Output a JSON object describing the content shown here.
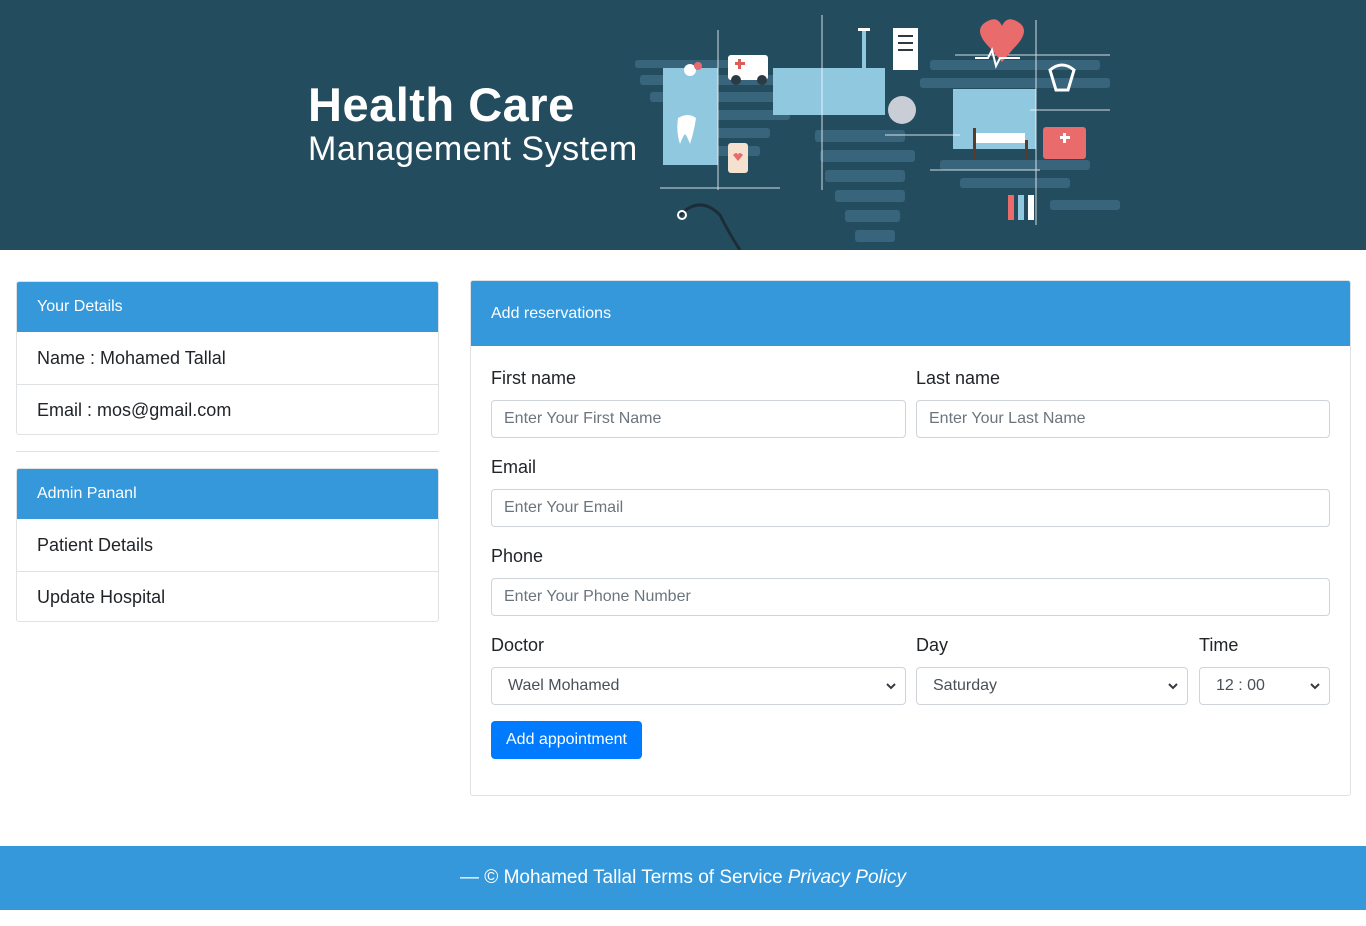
{
  "banner": {
    "title_line1": "Health Care",
    "title_line2": "Management System"
  },
  "details_card": {
    "header": "Your Details",
    "name": "Name : Mohamed Tallal",
    "email": "Email : mos@gmail.com"
  },
  "admin_card": {
    "header": "Admin Pananl",
    "items": [
      "Patient Details",
      "Update Hospital"
    ]
  },
  "form": {
    "header": "Add reservations",
    "first_name_label": "First name",
    "first_name_placeholder": "Enter Your First Name",
    "last_name_label": "Last name",
    "last_name_placeholder": "Enter Your Last Name",
    "email_label": "Email",
    "email_placeholder": "Enter Your Email",
    "phone_label": "Phone",
    "phone_placeholder": "Enter Your Phone Number",
    "doctor_label": "Doctor",
    "doctor_value": "Wael Mohamed",
    "day_label": "Day",
    "day_value": "Saturday",
    "time_label": "Time",
    "time_value": "12 : 00",
    "submit_label": "Add appointment"
  },
  "footer": {
    "text": "— © Mohamed Tallal Terms of Service",
    "privacy": "Privacy Policy"
  },
  "colors": {
    "banner_bg": "#244c5f",
    "accent": "#3498db",
    "button": "#007bff"
  }
}
